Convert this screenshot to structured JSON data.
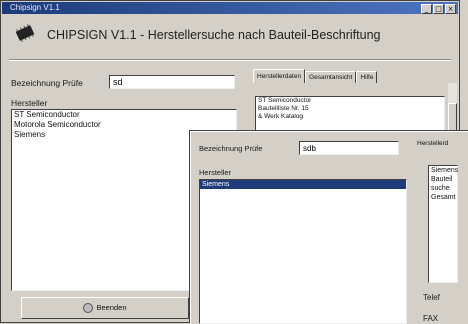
{
  "window": {
    "title": "Chipsign V1.1",
    "controls": [
      "_",
      "□",
      "×"
    ],
    "heading": "CHIPSIGN V1.1 - Herstellersuche nach Bauteil-Beschriftung"
  },
  "search": {
    "label": "Bezeichnung Prüfe",
    "value": "sd"
  },
  "manufacturers": {
    "label": "Hersteller",
    "items": [
      "ST Semiconductor",
      "Motorola Semiconductor",
      "Siemens"
    ]
  },
  "tabs": [
    "Herstellerdaten",
    "Gesamtansicht",
    "Hilfe"
  ],
  "details": {
    "lines": [
      "ST Semiconductor",
      "Bauteilliste Nr. 15",
      "& Werk Katalog"
    ]
  },
  "buttons": {
    "exit": "Beenden"
  },
  "second_window": {
    "search_label": "Bezeichnung Prüfe",
    "search_value": "sdb",
    "manufacturers_label": "Hersteller",
    "manufacturers": [
      "Siemens"
    ],
    "tab_fragment": "Herstellerd",
    "details": [
      "Siemens",
      "Bauteil",
      "suche",
      "Gesamt"
    ],
    "footer_labels": [
      "Telef",
      "FAX"
    ]
  },
  "colors": {
    "titlebar": "#1c3a7a",
    "selection": "#1f3d7a",
    "face": "#d4d0c8"
  }
}
